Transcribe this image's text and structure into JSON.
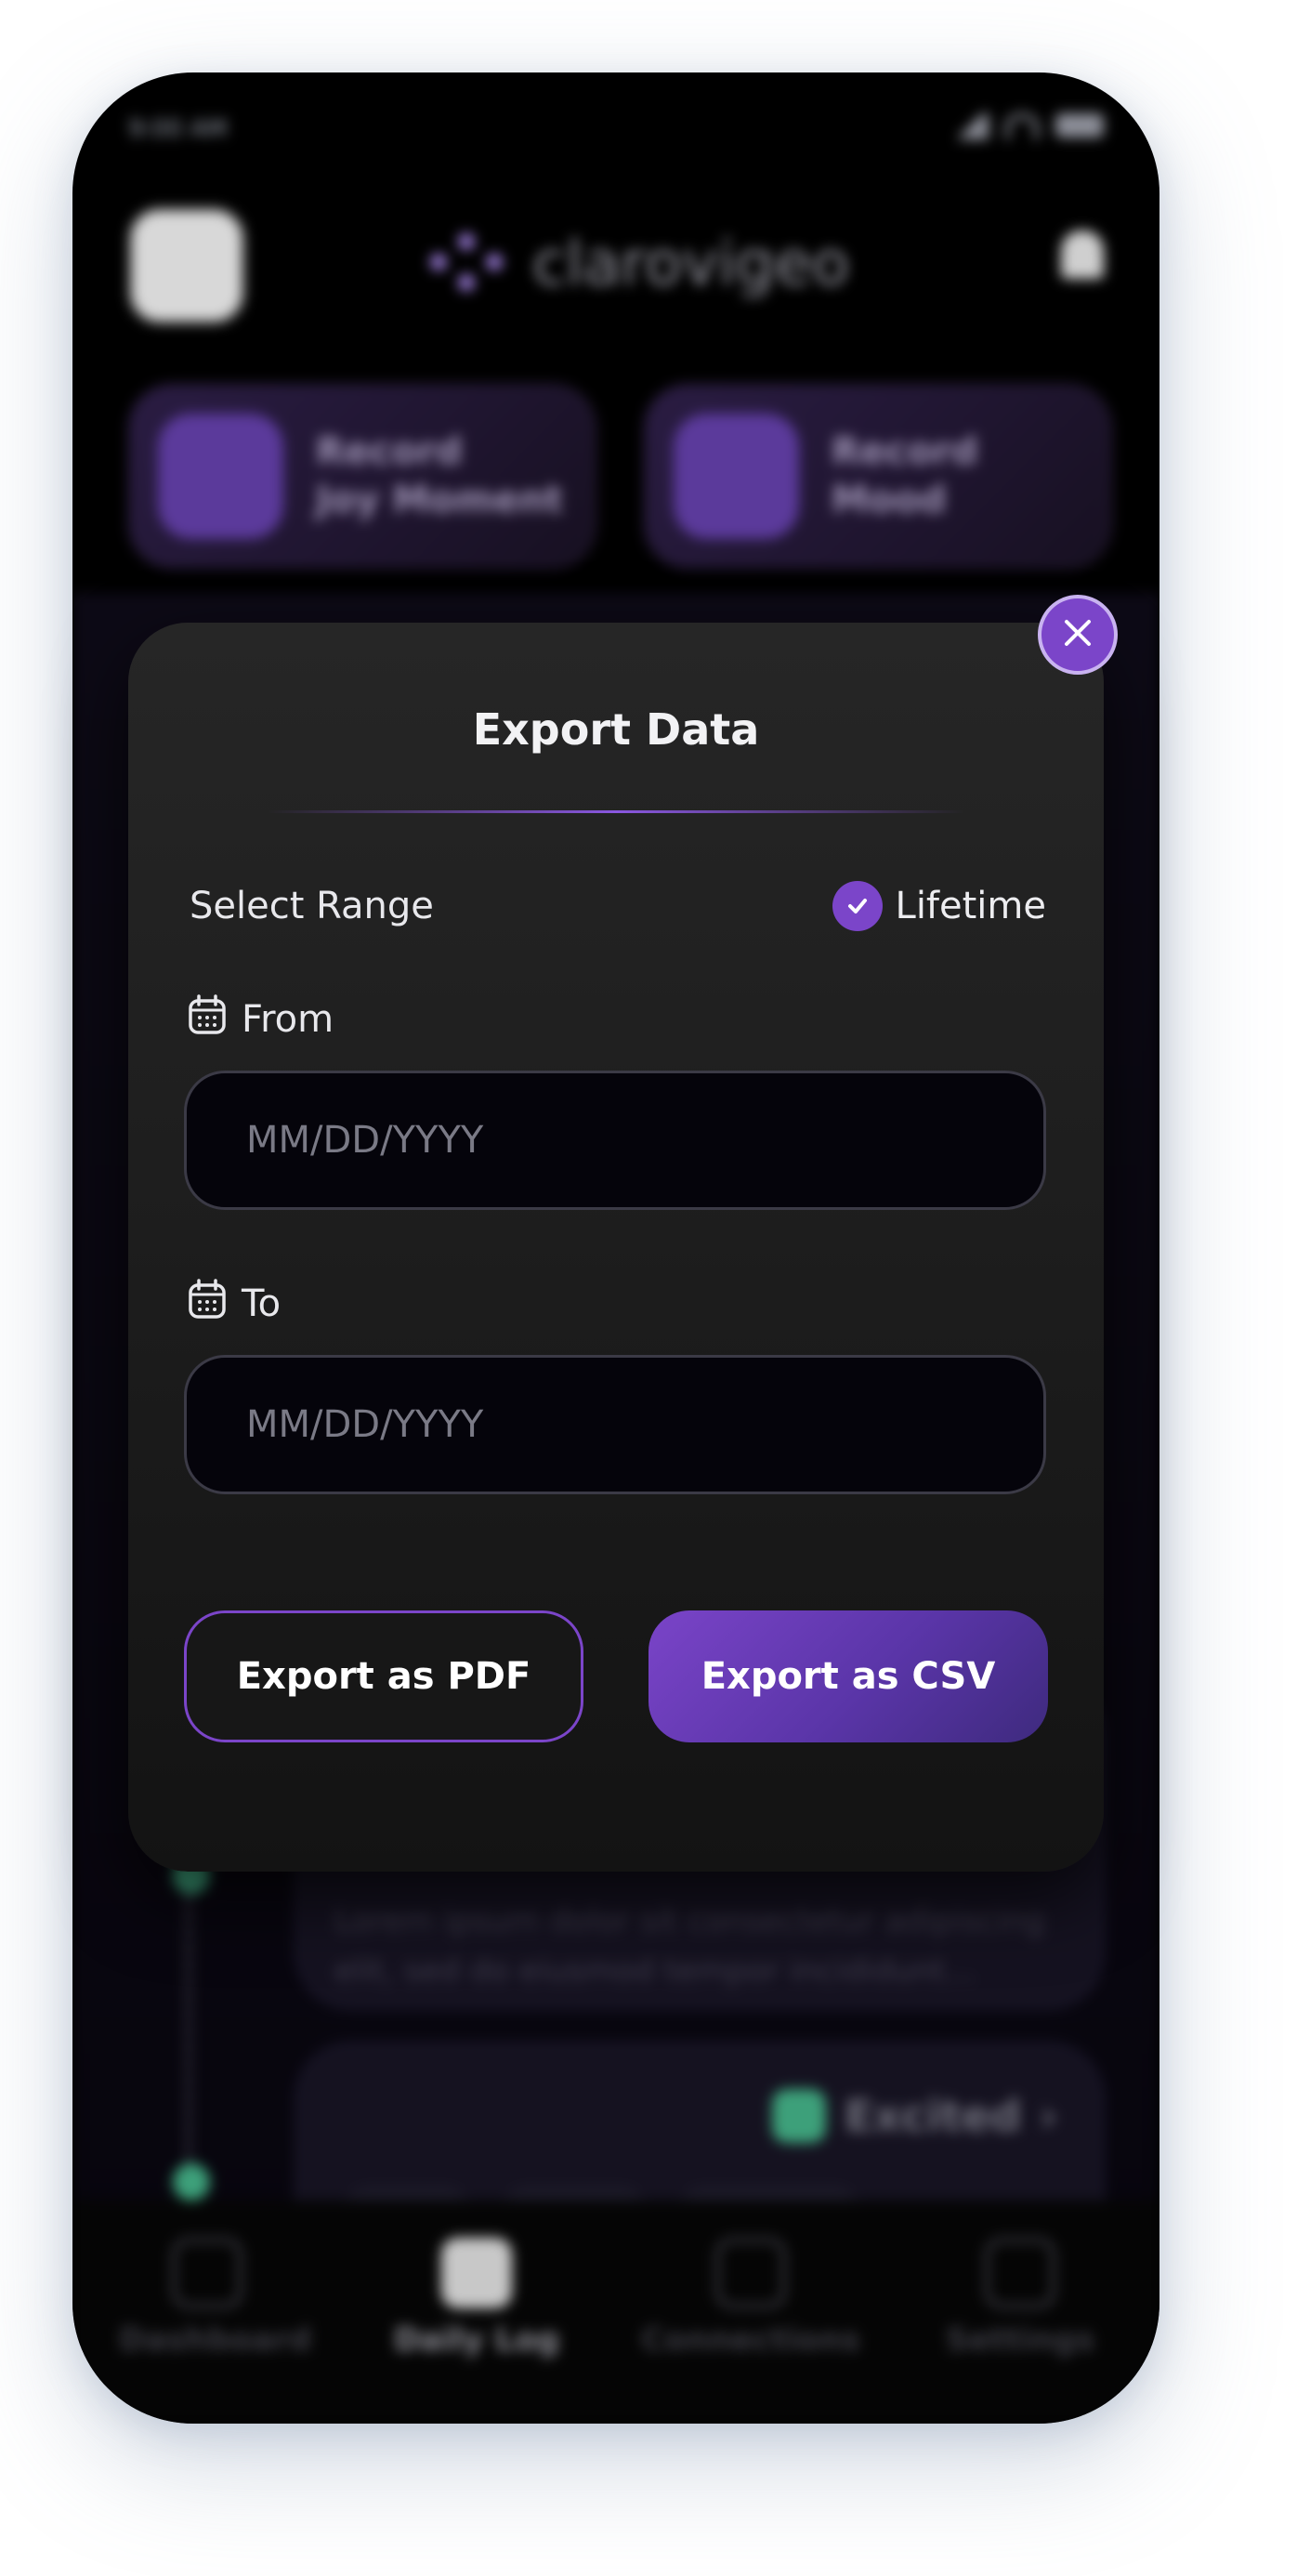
{
  "colors": {
    "accent": "#7b45c9",
    "modal_bg": "#1f1f1f",
    "input_bg": "#05040b",
    "placeholder": "#7a7a86",
    "success": "#3da07a"
  },
  "background": {
    "status": {
      "time": "9:00 AM"
    },
    "header": {
      "logo_text": "clarovigeo"
    },
    "quick_actions": [
      {
        "label_line1": "Record",
        "label_line2": "Joy Moment",
        "icon": "star-wand-icon"
      },
      {
        "label_line1": "Record",
        "label_line2": "Mood",
        "icon": "mood-grid-icon"
      }
    ],
    "entry_text": "Lorem ipsum dolor sit consectetur adipiscing elit, sed do eiusmod tempor incididunt...",
    "mood_badge": "Excited",
    "tab_bar": [
      {
        "label": "Dashboard",
        "icon": "dashboard-icon",
        "active": false
      },
      {
        "label": "Daily Log",
        "icon": "edit-icon",
        "active": true
      },
      {
        "label": "Connections",
        "icon": "connections-icon",
        "active": false
      },
      {
        "label": "Settings",
        "icon": "settings-icon",
        "active": false
      }
    ]
  },
  "modal": {
    "title": "Export Data",
    "select_range_label": "Select Range",
    "lifetime_label": "Lifetime",
    "lifetime_checked": true,
    "from_label": "From",
    "from_value": "",
    "from_placeholder": "MM/DD/YYYY",
    "to_label": "To",
    "to_value": "",
    "to_placeholder": "MM/DD/YYYY",
    "export_pdf_label": "Export as PDF",
    "export_csv_label": "Export as CSV"
  }
}
